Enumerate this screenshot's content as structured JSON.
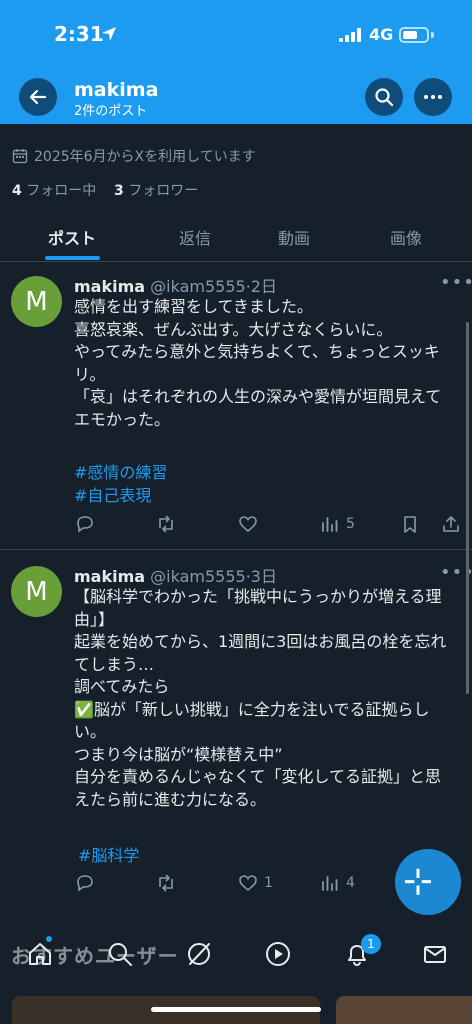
{
  "status_bar": {
    "time": "2:31",
    "network": "4G"
  },
  "header": {
    "name": "makima",
    "post_count": "2件のポスト"
  },
  "profile": {
    "joined": "2025年6月からXを利用しています",
    "following_count": "4",
    "following_label": "フォロー中",
    "followers_count": "3",
    "followers_label": "フォロワー"
  },
  "tabs": [
    {
      "label": "ポスト"
    },
    {
      "label": "返信"
    },
    {
      "label": "動画"
    },
    {
      "label": "画像"
    }
  ],
  "posts": [
    {
      "avatar_letter": "M",
      "name": "makima",
      "handle": "@ikam5555",
      "time": "2日",
      "text": "感情を出す練習をしてきました。\n喜怒哀楽、ぜんぶ出す。大げさなくらいに。\nやってみたら意外と気持ちよくて、ちょっとスッキリ。\n「哀」はそれぞれの人生の深みや愛情が垣間見えてエモかった。",
      "hashtags": [
        "#感情の練習",
        "#自己表現"
      ],
      "likes": "",
      "views": "5"
    },
    {
      "avatar_letter": "M",
      "name": "makima",
      "handle": "@ikam5555",
      "time": "3日",
      "text": "【脳科学でわかった「挑戦中にうっかりが増える理由」】\n起業を始めてから、1週間に3回はお風呂の栓を忘れてしまう…\n調べてみたら\n✅脳が「新しい挑戦」に全力を注いでる証拠らしい。\nつまり今は脳が“模様替え中”\n自分を責めるんじゃなくて「変化してる証拠」と思えたら前に進む力になる。",
      "hashtags": [
        "#脳科学"
      ],
      "likes": "1",
      "views": "4"
    }
  ],
  "overlay_text": "おすすめユーザー",
  "notifications_badge": "1",
  "colors": {
    "accent": "#1d9bf0",
    "background": "#15202b",
    "avatar": "#689f38"
  }
}
